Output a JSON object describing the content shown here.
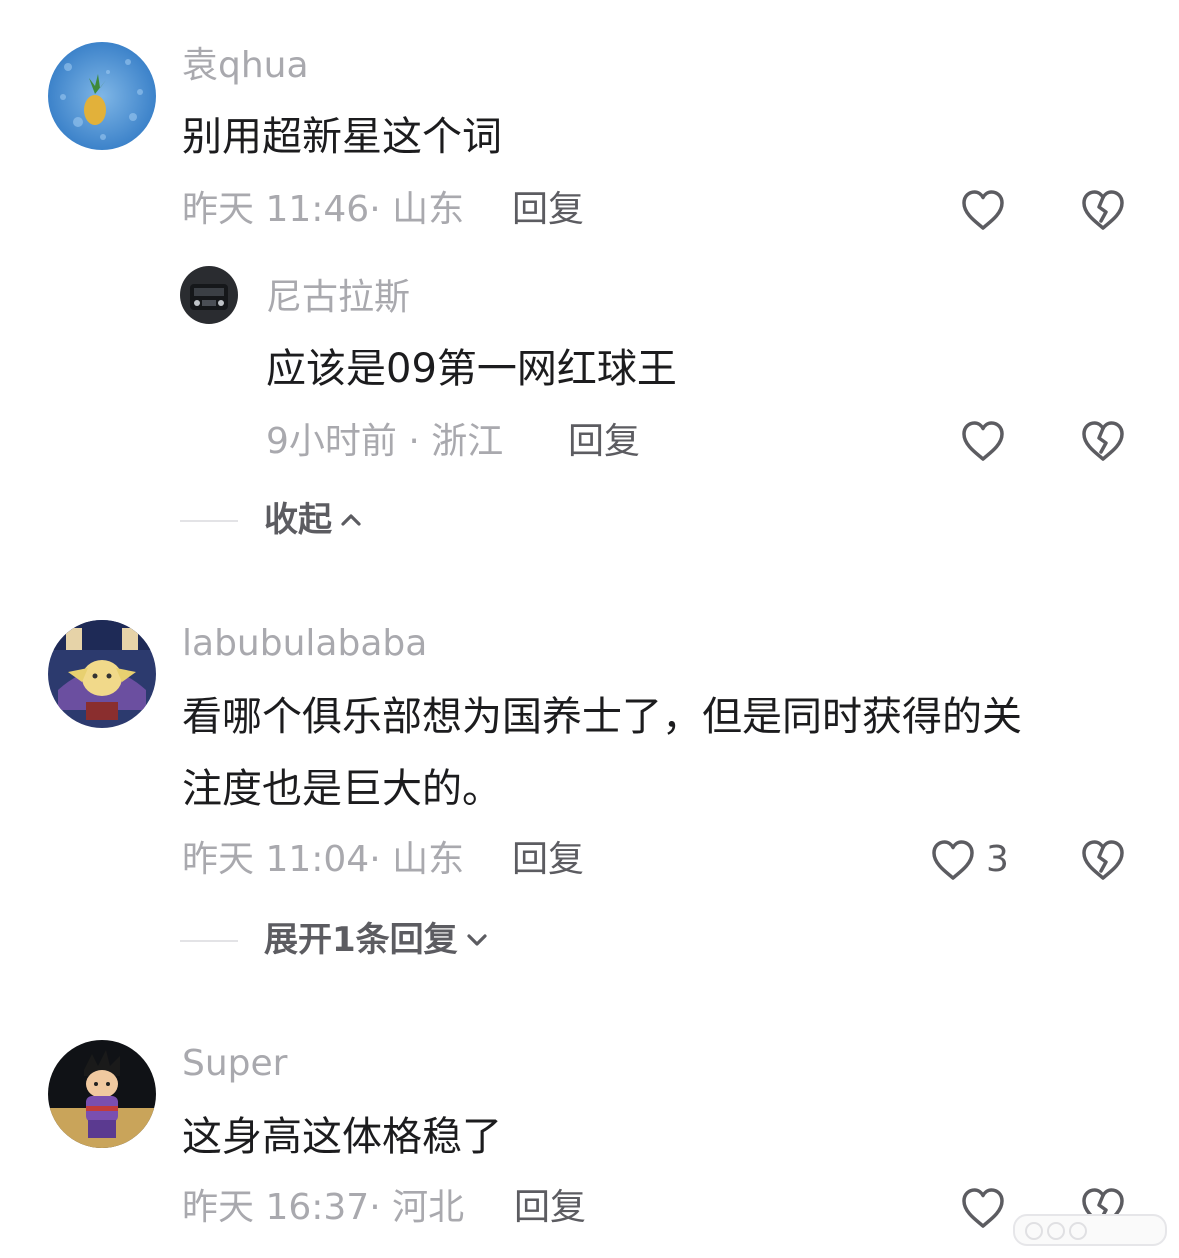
{
  "comments": [
    {
      "username": "袁qhua",
      "text": "别用超新星这个词",
      "time": "昨天 11:46",
      "location": "山东",
      "reply_label": "回复",
      "like_count": "",
      "replies": [
        {
          "username": "尼古拉斯",
          "text": "应该是09第一网红球王",
          "time": "9小时前",
          "location": "浙江",
          "reply_label": "回复"
        }
      ],
      "fold_label": "收起"
    },
    {
      "username": "labubulababa",
      "text_line1": "看哪个俱乐部想为国养士了，但是同时获得的关",
      "text_line2": "注度也是巨大的。",
      "time": "昨天 11:04",
      "location": "山东",
      "reply_label": "回复",
      "like_count": "3",
      "expand_label": "展开1条回复"
    },
    {
      "username": "Super",
      "text": "这身高这体格稳了",
      "time": "昨天 16:37",
      "location": "河北",
      "reply_label": "回复"
    }
  ],
  "icons": {
    "like": "heart-outline-icon",
    "dislike": "broken-heart-icon",
    "chevron_up": "chevron-up-icon",
    "chevron_down": "chevron-down-icon"
  },
  "colors": {
    "text": "#1c1c1e",
    "muted": "#a9a9ae",
    "secondary": "#5c5c61"
  }
}
